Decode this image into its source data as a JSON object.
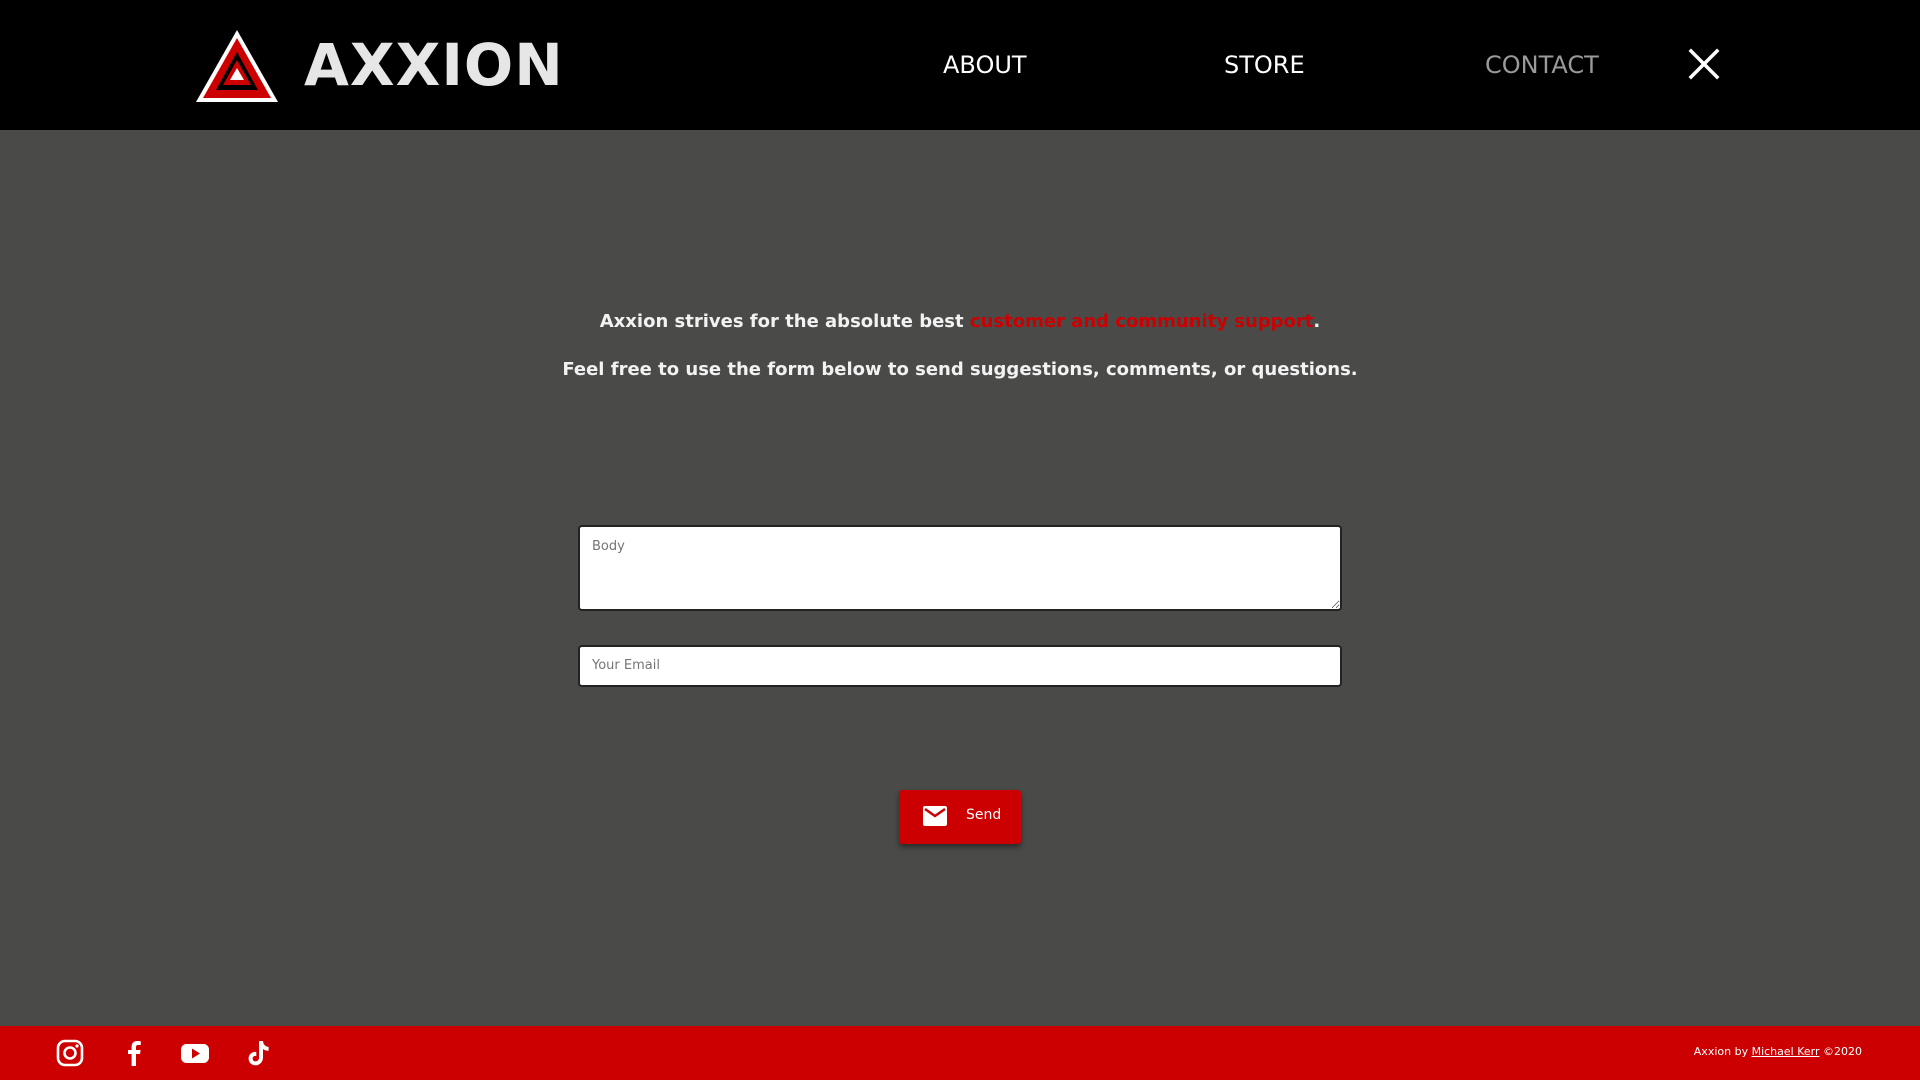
{
  "header": {
    "brand": "AXXION",
    "nav": {
      "about": "ABOUT",
      "store": "STORE",
      "contact": "CONTACT"
    },
    "icons": {
      "logo": "axxion-logo",
      "close": "close-icon"
    },
    "colors": {
      "background": "#000000",
      "accent": "#cc0000",
      "active_nav": "#9a9a9a"
    }
  },
  "intro": {
    "line1_before": "Axxion strives for the absolute best ",
    "line1_highlight": "customer and community support",
    "line1_after": ".",
    "line2": "Feel free to use the form below to send suggestions, comments, or questions."
  },
  "form": {
    "body_placeholder": "Body",
    "body_value": "",
    "email_placeholder": "Your Email",
    "email_value": "",
    "send_label": "Send",
    "send_icon": "mail-icon"
  },
  "footer": {
    "social_icons": [
      "instagram-icon",
      "facebook-icon",
      "youtube-icon",
      "tiktok-icon"
    ],
    "credit_prefix": "Axxion by ",
    "credit_author": "Michael Kerr",
    "credit_suffix": " ©2020",
    "background": "#cc0000"
  }
}
